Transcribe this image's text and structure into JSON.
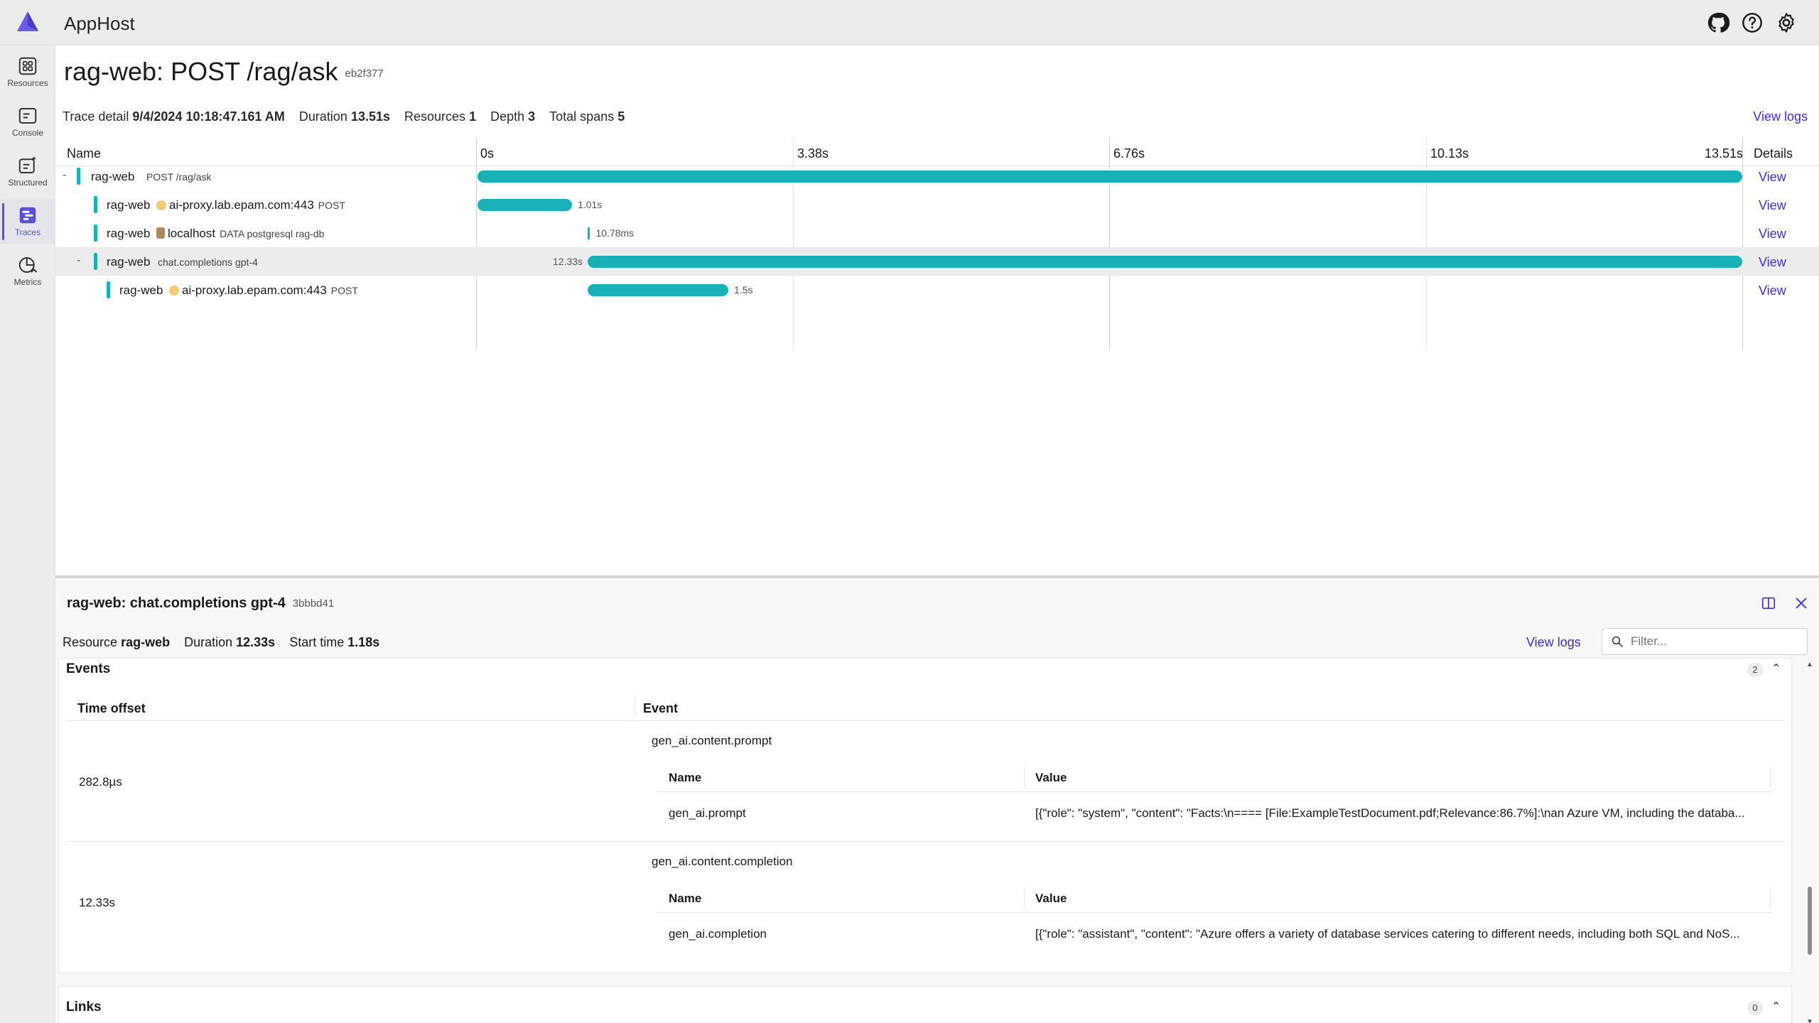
{
  "header": {
    "app_title": "AppHost"
  },
  "nav": [
    {
      "id": "resources",
      "label": "Resources",
      "icon": "resources-icon"
    },
    {
      "id": "console",
      "label": "Console",
      "icon": "console-icon"
    },
    {
      "id": "structured",
      "label": "Structured",
      "icon": "structured-logs-icon"
    },
    {
      "id": "traces",
      "label": "Traces",
      "icon": "traces-icon",
      "active": true
    },
    {
      "id": "metrics",
      "label": "Metrics",
      "icon": "metrics-icon"
    }
  ],
  "trace": {
    "title": "rag-web: POST /rag/ask",
    "id": "eb2f377",
    "summary": {
      "detail_label": "Trace detail",
      "detail_value": "9/4/2024 10:18:47.161 AM",
      "duration_label": "Duration",
      "duration_value": "13.51s",
      "resources_label": "Resources",
      "resources_value": "1",
      "depth_label": "Depth",
      "depth_value": "3",
      "spans_label": "Total spans",
      "spans_value": "5"
    },
    "view_logs": "View logs",
    "columns": {
      "name": "Name",
      "details": "Details"
    },
    "ticks": [
      "0s",
      "3.38s",
      "6.76s",
      "10.13s",
      "13.51s"
    ],
    "total_seconds": 13.51,
    "spans": [
      {
        "toggle": "-",
        "resource": "rag-web",
        "detail": "",
        "small": "POST /rag/ask",
        "start": 0,
        "duration": 13.51,
        "duration_label": "",
        "indent": 0,
        "marker": "none",
        "view": "View"
      },
      {
        "toggle": "",
        "resource": "rag-web",
        "detail": "ai-proxy.lab.epam.com:443",
        "small": "POST",
        "start": 0,
        "duration": 1.01,
        "duration_label": "1.01s",
        "indent": 1,
        "marker": "dot",
        "view": "View"
      },
      {
        "toggle": "",
        "resource": "rag-web",
        "detail": "localhost",
        "small": "DATA postgresql rag-db",
        "start": 1.18,
        "duration": 0.01078,
        "duration_label": "10.78ms",
        "indent": 1,
        "marker": "db",
        "view": "View"
      },
      {
        "toggle": "-",
        "resource": "rag-web",
        "detail": "",
        "small": "chat.completions gpt-4",
        "start": 1.18,
        "duration": 12.33,
        "duration_label": "12.33s",
        "indent": 1,
        "marker": "none",
        "view": "View",
        "selected": true
      },
      {
        "toggle": "",
        "resource": "rag-web",
        "detail": "ai-proxy.lab.epam.com:443",
        "small": "POST",
        "start": 1.18,
        "duration": 1.5,
        "duration_label": "1.5s",
        "indent": 2,
        "marker": "dot",
        "view": "View"
      }
    ]
  },
  "panel": {
    "title": "rag-web: chat.completions gpt-4",
    "id": "3bbbd41",
    "resource_label": "Resource",
    "resource_value": "rag-web",
    "duration_label": "Duration",
    "duration_value": "12.33s",
    "start_label": "Start time",
    "start_value": "1.18s",
    "view_logs": "View logs",
    "filter_placeholder": "Filter...",
    "events": {
      "title": "Events",
      "count": "2",
      "col_offset": "Time offset",
      "col_event": "Event",
      "sub_name": "Name",
      "sub_value": "Value",
      "rows": [
        {
          "offset": "282.8µs",
          "event": "gen_ai.content.prompt",
          "name": "gen_ai.prompt",
          "value": "[{\"role\": \"system\", \"content\": \"Facts:\\n==== [File:ExampleTestDocument.pdf;Relevance:86.7%]:\\nan Azure VM, including the databa..."
        },
        {
          "offset": "12.33s",
          "event": "gen_ai.content.completion",
          "name": "gen_ai.completion",
          "value": "[{\"role\": \"assistant\", \"content\": \"Azure offers a variety of database services catering to different needs, including both SQL and NoS..."
        }
      ]
    },
    "links": {
      "title": "Links",
      "count": "0"
    }
  },
  "colors": {
    "accent": "#5b4fd6",
    "bar": "#18b1b7",
    "link": "#3d2ed3"
  }
}
